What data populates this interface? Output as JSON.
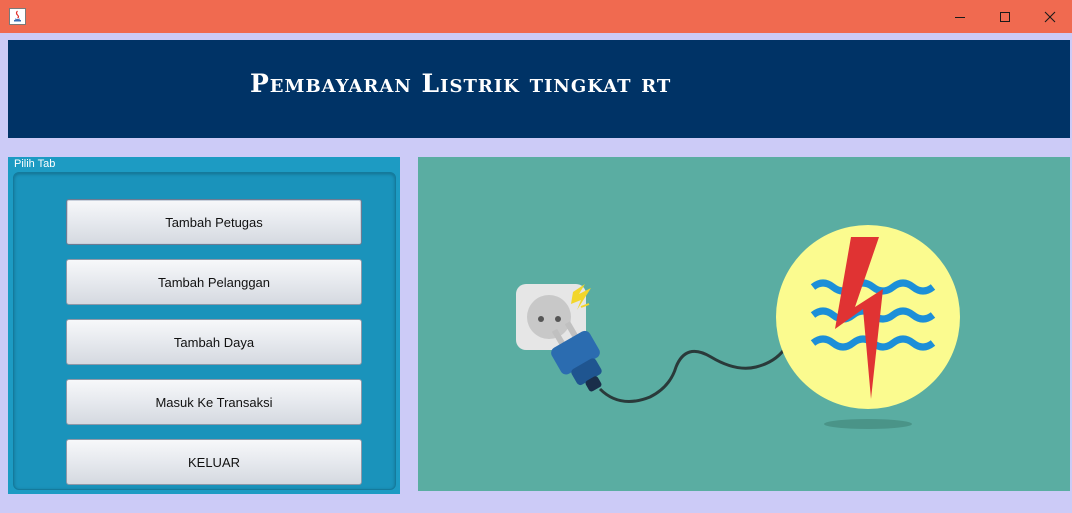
{
  "window": {
    "title": "",
    "controls": {
      "minimize": "minimize-icon",
      "maximize": "maximize-icon",
      "close": "close-icon"
    },
    "titlebar_color": "#f06a50",
    "background_color": "#cccbf7"
  },
  "header": {
    "title": "Pembayaran Listrik tingkat rt",
    "background_color": "#003366"
  },
  "tab_panel": {
    "label": "Pilih Tab",
    "background_color": "#1d9bc3",
    "buttons": [
      {
        "label": "Tambah Petugas"
      },
      {
        "label": "Tambah Pelanggan"
      },
      {
        "label": "Tambah Daya"
      },
      {
        "label": "Masuk Ke Transaksi"
      },
      {
        "label": "KELUAR"
      }
    ]
  },
  "illustration": {
    "subject": "plug-and-pln-logo",
    "background_color": "#5aada2"
  }
}
